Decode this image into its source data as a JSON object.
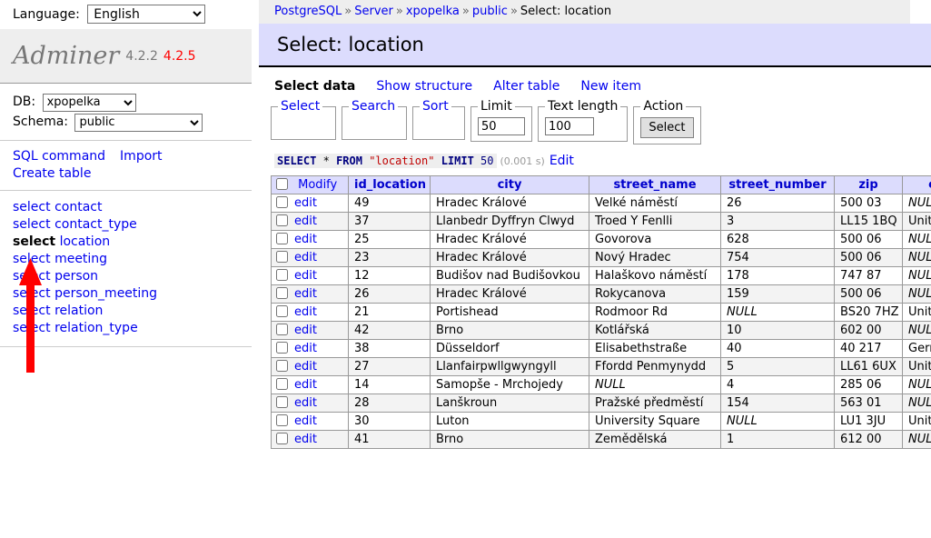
{
  "sidebar": {
    "language_label": "Language:",
    "language_value": "English",
    "language_options": [
      "English"
    ],
    "logo": "Adminer",
    "version": "4.2.2",
    "version_new": "4.2.5",
    "db_label": "DB:",
    "db_value": "xpopelka",
    "db_options": [
      "xpopelka"
    ],
    "schema_label": "Schema:",
    "schema_value": "public",
    "schema_options": [
      "public"
    ],
    "sql_command": "SQL command",
    "import": "Import",
    "create_table": "Create table",
    "select_word": "select",
    "tables": [
      {
        "name": "contact",
        "active": false
      },
      {
        "name": "contact_type",
        "active": false
      },
      {
        "name": "location",
        "active": true
      },
      {
        "name": "meeting",
        "active": false
      },
      {
        "name": "person",
        "active": false
      },
      {
        "name": "person_meeting",
        "active": false
      },
      {
        "name": "relation",
        "active": false
      },
      {
        "name": "relation_type",
        "active": false
      }
    ],
    "annotation_arrow_color": "#ff0000"
  },
  "breadcrumb": {
    "server_type": "PostgreSQL",
    "server": "Server",
    "database": "xpopelka",
    "schema": "public",
    "current": "Select: location",
    "separator": "»"
  },
  "header": {
    "title": "Select: location",
    "bg_color": "#dcdcfd"
  },
  "menu": {
    "active": "Select data",
    "items": [
      "Show structure",
      "Alter table",
      "New item"
    ]
  },
  "controls": {
    "select_legend": "Select",
    "search_legend": "Search",
    "sort_legend": "Sort",
    "limit_legend": "Limit",
    "limit_value": "50",
    "text_length_legend": "Text length",
    "text_length_value": "100",
    "action_legend": "Action",
    "action_button": "Select"
  },
  "sql": {
    "kw_select": "SELECT",
    "star": "*",
    "kw_from": "FROM",
    "table": "\"location\"",
    "kw_limit": "LIMIT",
    "limit": "50",
    "time": "(0.001 s)",
    "edit": "Edit"
  },
  "table": {
    "modify_header": "Modify",
    "edit_label": "edit",
    "columns": [
      "id_location",
      "city",
      "street_name",
      "street_number",
      "zip",
      "c"
    ],
    "rows": [
      {
        "id_location": "49",
        "city": "Hradec Králové",
        "street_name": "Velké náměstí",
        "street_number": "26",
        "zip": "500 03",
        "country": "NULL"
      },
      {
        "id_location": "37",
        "city": "Llanbedr Dyffryn Clwyd",
        "street_name": "Troed Y Fenlli",
        "street_number": "3",
        "zip": "LL15 1BQ",
        "country": "Unite"
      },
      {
        "id_location": "25",
        "city": "Hradec Králové",
        "street_name": "Govorova",
        "street_number": "628",
        "zip": "500 06",
        "country": "NULL"
      },
      {
        "id_location": "23",
        "city": "Hradec Králové",
        "street_name": "Nový Hradec",
        "street_number": "754",
        "zip": "500 06",
        "country": "NULL"
      },
      {
        "id_location": "12",
        "city": "Budišov nad Budišovkou",
        "street_name": "Halaškovo náměstí",
        "street_number": "178",
        "zip": "747 87",
        "country": "NULL"
      },
      {
        "id_location": "26",
        "city": "Hradec Králové",
        "street_name": "Rokycanova",
        "street_number": "159",
        "zip": "500 06",
        "country": "NULL"
      },
      {
        "id_location": "21",
        "city": "Portishead",
        "street_name": "Rodmoor Rd",
        "street_number": "NULL",
        "zip": "BS20 7HZ",
        "country": "Unite"
      },
      {
        "id_location": "42",
        "city": "Brno",
        "street_name": "Kotlářská",
        "street_number": "10",
        "zip": "602 00",
        "country": "NULL"
      },
      {
        "id_location": "38",
        "city": "Düsseldorf",
        "street_name": "Elisabethstraße",
        "street_number": "40",
        "zip": "40 217",
        "country": "Germ"
      },
      {
        "id_location": "27",
        "city": "Llanfairpwllgwyngyll",
        "street_name": "Ffordd Penmynydd",
        "street_number": "5",
        "zip": "LL61 6UX",
        "country": "Unite"
      },
      {
        "id_location": "14",
        "city": "Samopše - Mrchojedy",
        "street_name": "NULL",
        "street_number": "4",
        "zip": "285 06",
        "country": "NULL"
      },
      {
        "id_location": "28",
        "city": "Lanškroun",
        "street_name": "Pražské předměstí",
        "street_number": "154",
        "zip": "563 01",
        "country": "NULL"
      },
      {
        "id_location": "30",
        "city": "Luton",
        "street_name": "University Square",
        "street_number": "NULL",
        "zip": "LU1 3JU",
        "country": "Unite"
      },
      {
        "id_location": "41",
        "city": "Brno",
        "street_name": "Zemědělská",
        "street_number": "1",
        "zip": "612 00",
        "country": "NULL"
      }
    ]
  }
}
